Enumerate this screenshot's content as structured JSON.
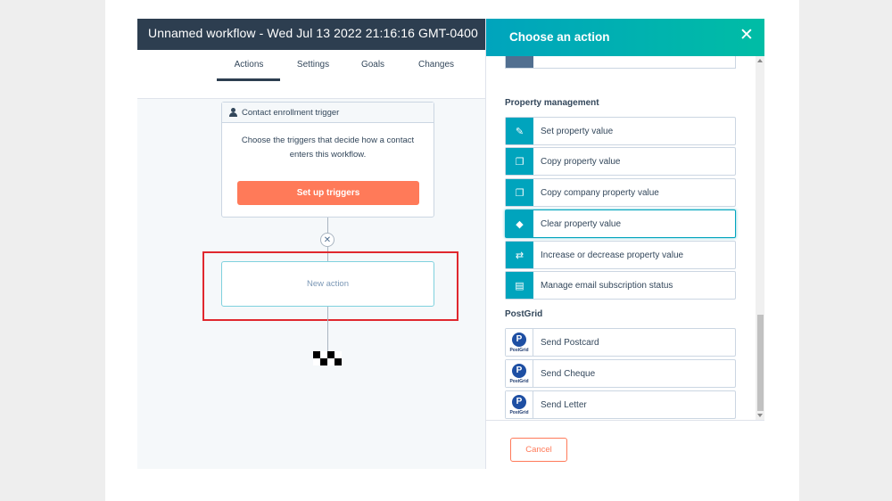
{
  "workflow": {
    "title": "Unnamed workflow - Wed Jul 13 2022 21:16:16 GMT-0400"
  },
  "tabs": [
    {
      "label": "Actions",
      "active": true
    },
    {
      "label": "Settings"
    },
    {
      "label": "Goals"
    },
    {
      "label": "Changes"
    }
  ],
  "trigger": {
    "header": "Contact enrollment trigger",
    "description": "Choose the triggers that decide how a contact enters this workflow.",
    "button": "Set up triggers"
  },
  "new_action": {
    "label": "New action",
    "close_symbol": "✕"
  },
  "panel": {
    "title": "Choose an action",
    "close_symbol": "✕",
    "sections": [
      {
        "label": "Property management",
        "items": [
          {
            "label": "Set property value",
            "icon": "edit-icon",
            "glyph": "✎"
          },
          {
            "label": "Copy property value",
            "icon": "copy-icon",
            "glyph": "❐"
          },
          {
            "label": "Copy company property value",
            "icon": "copy-icon",
            "glyph": "❐"
          },
          {
            "label": "Clear property value",
            "icon": "eraser-icon",
            "glyph": "◆",
            "active": true
          },
          {
            "label": "Increase or decrease property value",
            "icon": "swap-icon",
            "glyph": "⇄"
          },
          {
            "label": "Manage email subscription status",
            "icon": "newspaper-icon",
            "glyph": "▤"
          }
        ]
      },
      {
        "label": "PostGrid",
        "items": [
          {
            "label": "Send Postcard",
            "icon": "postgrid-logo-icon"
          },
          {
            "label": "Send Cheque",
            "icon": "postgrid-logo-icon"
          },
          {
            "label": "Send Letter",
            "icon": "postgrid-logo-icon"
          }
        ]
      }
    ],
    "postgrid_logo": {
      "letter": "P",
      "text": "PostGrid"
    },
    "cancel": "Cancel"
  },
  "colors": {
    "topbar": "#2d3e50",
    "accent": "#00a4bd",
    "cta": "#ff7a59",
    "highlight": "#e0282e"
  }
}
